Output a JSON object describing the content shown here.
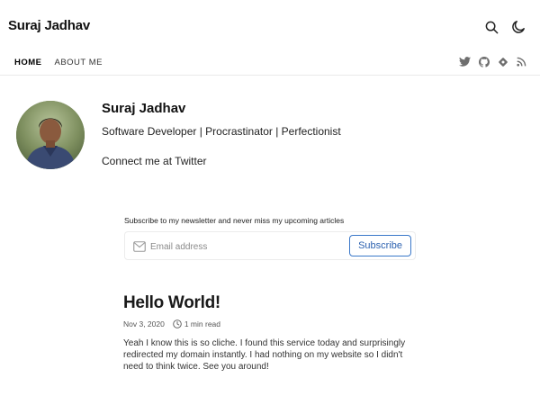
{
  "site": {
    "title": "Suraj Jadhav"
  },
  "header": {
    "icons": [
      "search-icon",
      "moon-icon"
    ]
  },
  "nav": {
    "items": [
      {
        "label": "HOME",
        "active": true
      },
      {
        "label": "ABOUT ME",
        "active": false
      }
    ]
  },
  "social": {
    "icons": [
      "twitter-icon",
      "github-icon",
      "dev-icon",
      "rss-icon"
    ]
  },
  "profile": {
    "name": "Suraj Jadhav",
    "bio": "Software Developer | Procrastinator | Perfectionist",
    "connect": "Connect me at Twitter"
  },
  "newsletter": {
    "label": "Subscribe to my newsletter and never miss my upcoming articles",
    "placeholder": "Email address",
    "button": "Subscribe"
  },
  "post": {
    "title": "Hello World!",
    "date": "Nov 3, 2020",
    "read_time": "1 min read",
    "excerpt": "Yeah I know this is so cliche. I found this service today and surprisingly redirected my domain instantly. I had nothing on my website so I didn't need to think twice. See you around!"
  },
  "colors": {
    "accent": "#2d62b0",
    "text": "#111111",
    "muted": "#555555"
  }
}
